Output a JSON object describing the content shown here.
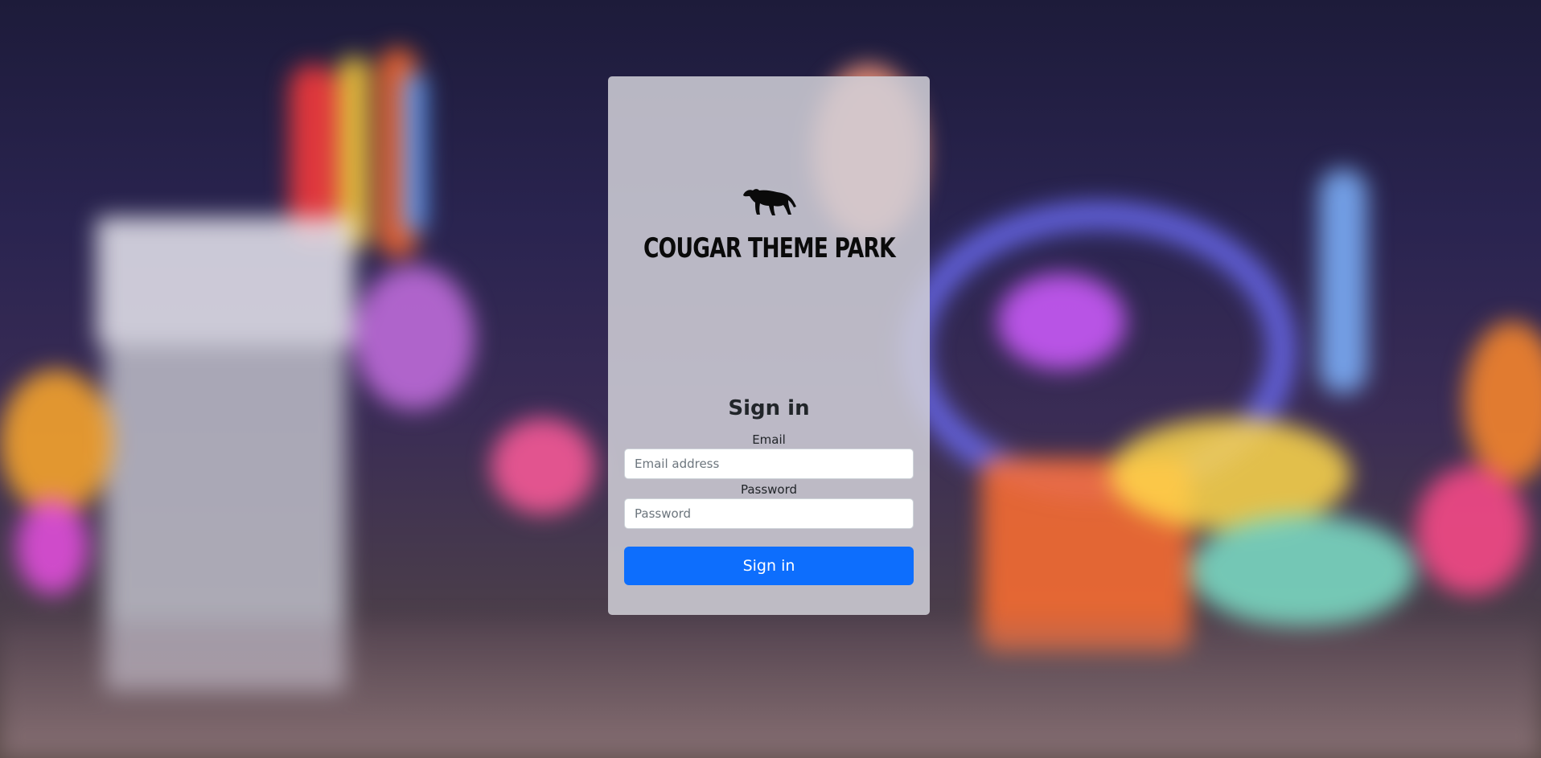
{
  "brand": {
    "name": "COUGAR THEME PARK",
    "logo_icon": "cougar-icon"
  },
  "signin": {
    "title": "Sign in",
    "email_label": "Email",
    "email_placeholder": "Email address",
    "email_value": "",
    "password_label": "Password",
    "password_placeholder": "Password",
    "password_value": "",
    "submit_label": "Sign in"
  },
  "colors": {
    "primary": "#0d6efd",
    "card_bg": "#d2d0d8",
    "text": "#212529"
  }
}
